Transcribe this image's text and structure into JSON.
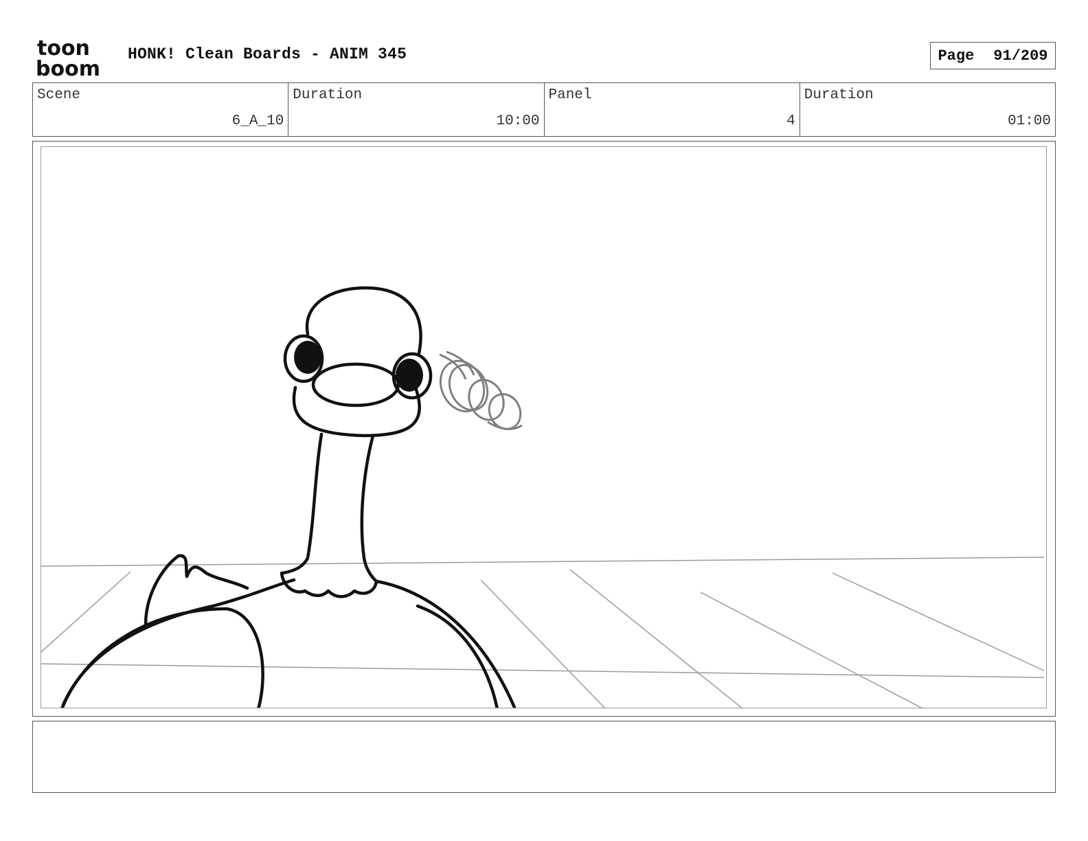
{
  "header": {
    "logo_top": "toon",
    "logo_bottom": "boom",
    "title": "HONK! Clean Boards - ANIM 345",
    "page_label": "Page",
    "page_value": "91/209"
  },
  "info": {
    "scene_label": "Scene",
    "scene_value": "6_A_10",
    "duration_label": "Duration",
    "duration_value": "10:00",
    "panel_label": "Panel",
    "panel_value": "4",
    "panel_duration_label": "Duration",
    "panel_duration_value": "01:00"
  },
  "caption": {
    "text": ""
  }
}
